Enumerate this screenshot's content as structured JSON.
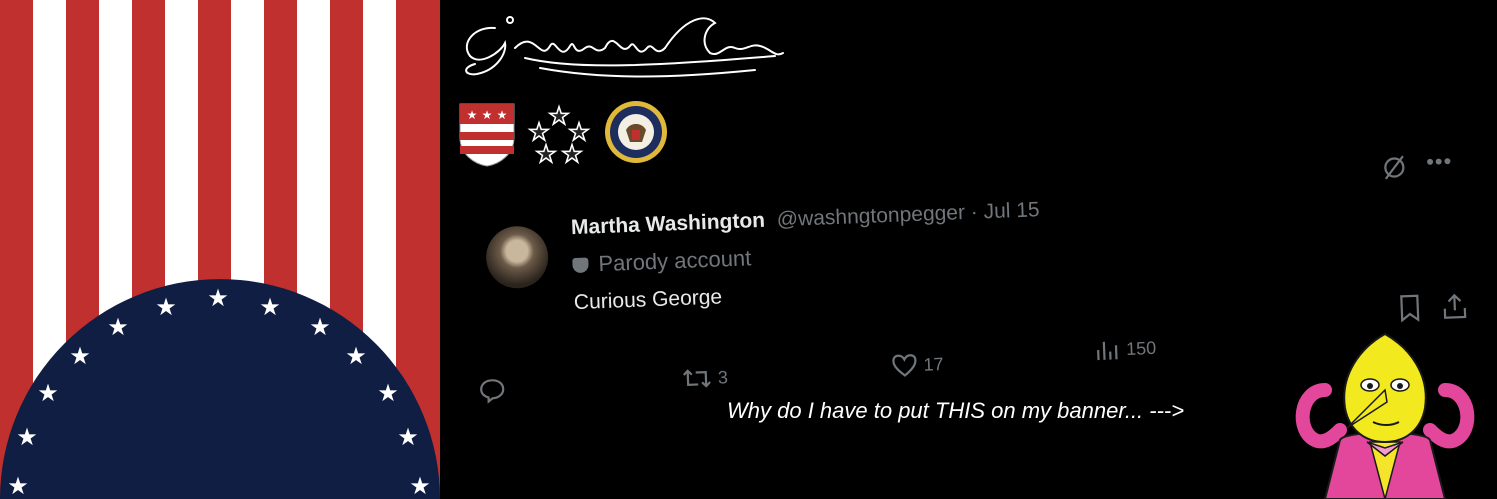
{
  "signature_text": "G.Washington",
  "badges": [
    "washington-crest-icon",
    "five-star-general-icon",
    "presidential-seal-icon"
  ],
  "tweet": {
    "display_name": "Martha Washington",
    "handle_date": "@washngtonpegger · Jul 15",
    "parody_label": "Parody account",
    "text": "Curious George",
    "retweets": "3",
    "likes": "17",
    "views": "150"
  },
  "caption": "Why do I have to put THIS on my banner... --->",
  "colors": {
    "red": "#c0302f",
    "white": "#ffffff",
    "navy": "#0f1e42",
    "background": "#000000",
    "muted": "#71767b"
  }
}
